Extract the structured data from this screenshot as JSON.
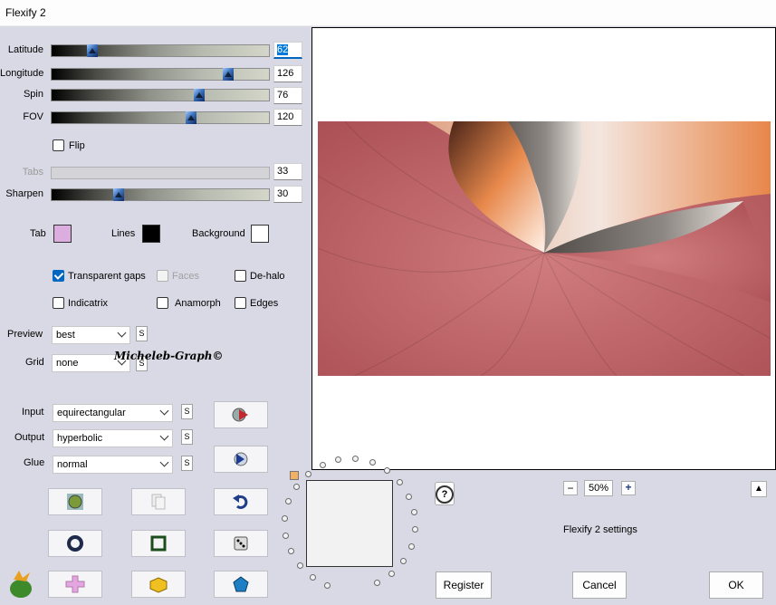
{
  "window": {
    "title": "Flexify 2"
  },
  "sliders": [
    {
      "key": "latitude",
      "label": "Latitude",
      "value": "62",
      "fraction": 0.17
    },
    {
      "key": "longitude",
      "label": "Longitude",
      "value": "126",
      "fraction": 0.83
    },
    {
      "key": "spin",
      "label": "Spin",
      "value": "76",
      "fraction": 0.69
    },
    {
      "key": "fov",
      "label": "FOV",
      "value": "120",
      "fraction": 0.65
    },
    {
      "key": "tabs",
      "label": "Tabs",
      "value": "33",
      "disabled": true
    },
    {
      "key": "sharpen",
      "label": "Sharpen",
      "value": "30",
      "fraction": 0.3
    }
  ],
  "flip": {
    "label": "Flip",
    "checked": false
  },
  "colors": {
    "tab": {
      "label": "Tab",
      "value": "#dcaee0"
    },
    "lines": {
      "label": "Lines",
      "value": "#000000"
    },
    "background": {
      "label": "Background",
      "value": "#ffffff"
    }
  },
  "options": {
    "transparent_gaps": {
      "label": "Transparent gaps",
      "checked": true
    },
    "faces": {
      "label": "Faces",
      "checked": false,
      "disabled": true
    },
    "de_halo": {
      "label": "De-halo",
      "checked": false
    },
    "indicatrix": {
      "label": "Indicatrix",
      "checked": false
    },
    "anamorph": {
      "label": "Anamorph",
      "checked": false
    },
    "edges": {
      "label": "Edges",
      "checked": false
    }
  },
  "preview": {
    "label": "Preview",
    "value": "best"
  },
  "grid": {
    "label": "Grid",
    "value": "none"
  },
  "signature": "Micheleb-Graph©",
  "input": {
    "label": "Input",
    "value": "equirectangular"
  },
  "output": {
    "label": "Output",
    "value": "hyperbolic"
  },
  "glue": {
    "label": "Glue",
    "value": "normal"
  },
  "s_label": "S",
  "zoom": {
    "minus": "−",
    "value": "50%",
    "plus": "+"
  },
  "help_label": "?",
  "settings_label": "Flexify 2 settings",
  "buttons": {
    "register": "Register",
    "cancel": "Cancel",
    "ok": "OK"
  },
  "colors_ui": {
    "image_pink": "#b9555a",
    "image_orange": "#e88a4c",
    "image_gray": "#6b6764"
  }
}
